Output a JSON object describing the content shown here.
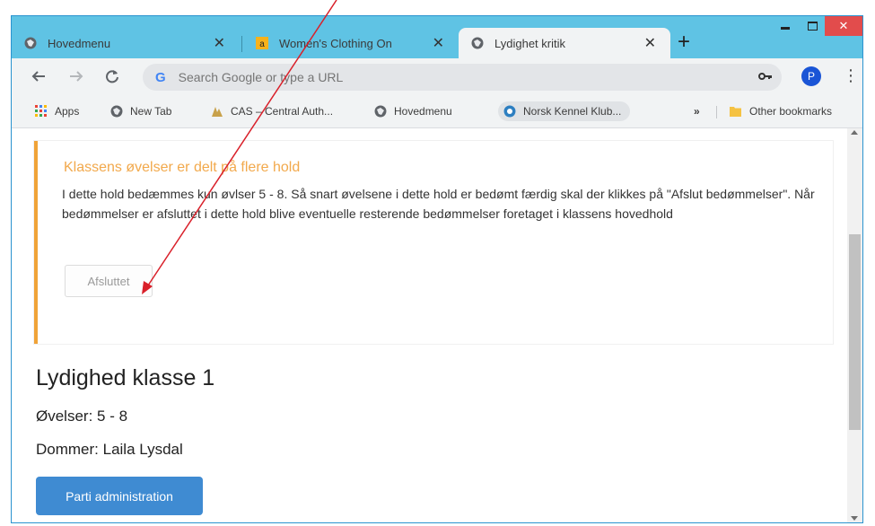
{
  "tabs": [
    {
      "title": "Hovedmenu",
      "favicon": "globe-icon"
    },
    {
      "title": "Women's Clothing On",
      "favicon": "amazon-icon"
    },
    {
      "title": "Lydighet kritik",
      "favicon": "globe-icon",
      "active": true
    }
  ],
  "toolbar": {
    "omnibox_placeholder": "Search Google or type a URL",
    "profile_initial": "P"
  },
  "bookmarks": {
    "items": [
      {
        "label": "Apps",
        "icon": "apps-grid-icon"
      },
      {
        "label": "New Tab",
        "icon": "globe-icon"
      },
      {
        "label": "CAS – Central Auth...",
        "icon": "cas-icon"
      },
      {
        "label": "Hovedmenu",
        "icon": "globe-icon"
      },
      {
        "label": "Norsk Kennel Klub...",
        "icon": "nkk-icon"
      }
    ],
    "overflow": "»",
    "other": "Other bookmarks"
  },
  "alert": {
    "title": "Klassens øvelser er delt på flere hold",
    "text": "I dette hold bedæmmes kun øvlser 5 - 8. Så snart øvelsene i dette hold er bedømt færdig skal der klikkes på \"Afslut bedømmelser\". Når bedømmelser er afsluttet i dette hold blive eventuelle resterende bedømmelser foretaget i klassens hovedhold",
    "button": "Afsluttet"
  },
  "class_info": {
    "title": "Lydighed klasse 1",
    "exercises": "Øvelser: 5 - 8",
    "judge": "Dommer: Laila Lysdal"
  },
  "footer": {
    "button": "Parti administration"
  },
  "colors": {
    "tabstrip": "#5fc3e4",
    "alert_accent": "#f0a338",
    "primary_button": "#3f8bd2",
    "annotation_arrow": "#d9202a"
  }
}
